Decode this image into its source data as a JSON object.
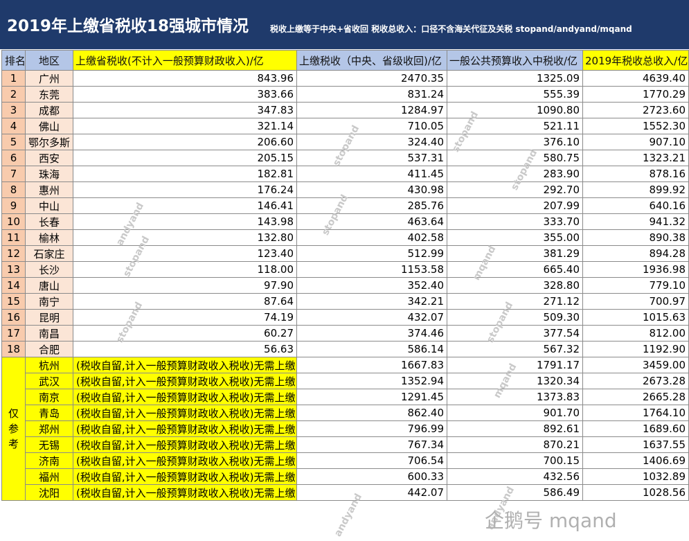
{
  "header": {
    "title": "2019年上缴省税收18强城市情况",
    "note": "税收上缴等于中央+省收回   税收总收入：口径不含海关代征及关税   stopand/andyand/mqand"
  },
  "columns": [
    "排名",
    "地区",
    "上缴省税收(不计入一般预算财政收入)/亿",
    "上缴税收（中央、省级收回)/亿",
    "一般公共预算收入中税收/亿",
    "2019年税收总收入/亿"
  ],
  "rows": [
    {
      "rank": "1",
      "city": "广州",
      "province_tax": "843.96",
      "upper_tax": "2470.35",
      "local_tax": "1325.09",
      "total": "4639.40"
    },
    {
      "rank": "2",
      "city": "东莞",
      "province_tax": "383.66",
      "upper_tax": "831.24",
      "local_tax": "555.39",
      "total": "1770.29"
    },
    {
      "rank": "3",
      "city": "成都",
      "province_tax": "347.83",
      "upper_tax": "1284.97",
      "local_tax": "1090.80",
      "total": "2723.60"
    },
    {
      "rank": "4",
      "city": "佛山",
      "province_tax": "321.14",
      "upper_tax": "710.05",
      "local_tax": "521.11",
      "total": "1552.30"
    },
    {
      "rank": "5",
      "city": "鄂尔多斯",
      "province_tax": "206.60",
      "upper_tax": "324.40",
      "local_tax": "376.10",
      "total": "907.10"
    },
    {
      "rank": "6",
      "city": "西安",
      "province_tax": "205.15",
      "upper_tax": "537.31",
      "local_tax": "580.75",
      "total": "1323.21"
    },
    {
      "rank": "7",
      "city": "珠海",
      "province_tax": "182.81",
      "upper_tax": "411.45",
      "local_tax": "283.90",
      "total": "878.16"
    },
    {
      "rank": "8",
      "city": "惠州",
      "province_tax": "176.24",
      "upper_tax": "430.98",
      "local_tax": "292.70",
      "total": "899.92"
    },
    {
      "rank": "9",
      "city": "中山",
      "province_tax": "146.41",
      "upper_tax": "285.76",
      "local_tax": "207.99",
      "total": "640.16"
    },
    {
      "rank": "10",
      "city": "长春",
      "province_tax": "143.98",
      "upper_tax": "463.64",
      "local_tax": "333.70",
      "total": "941.32"
    },
    {
      "rank": "11",
      "city": "榆林",
      "province_tax": "132.80",
      "upper_tax": "402.58",
      "local_tax": "355.00",
      "total": "890.38"
    },
    {
      "rank": "12",
      "city": "石家庄",
      "province_tax": "123.40",
      "upper_tax": "512.99",
      "local_tax": "381.29",
      "total": "894.28"
    },
    {
      "rank": "13",
      "city": "长沙",
      "province_tax": "118.00",
      "upper_tax": "1153.58",
      "local_tax": "665.40",
      "total": "1936.98"
    },
    {
      "rank": "14",
      "city": "唐山",
      "province_tax": "97.90",
      "upper_tax": "352.40",
      "local_tax": "328.80",
      "total": "779.10"
    },
    {
      "rank": "15",
      "city": "南宁",
      "province_tax": "87.64",
      "upper_tax": "342.21",
      "local_tax": "271.12",
      "total": "700.97"
    },
    {
      "rank": "16",
      "city": "昆明",
      "province_tax": "74.19",
      "upper_tax": "432.07",
      "local_tax": "509.30",
      "total": "1015.63"
    },
    {
      "rank": "17",
      "city": "南昌",
      "province_tax": "60.27",
      "upper_tax": "374.46",
      "local_tax": "377.54",
      "total": "812.00"
    },
    {
      "rank": "18",
      "city": "合肥",
      "province_tax": "56.63",
      "upper_tax": "586.14",
      "local_tax": "567.32",
      "total": "1192.90"
    }
  ],
  "reference": {
    "label": "仅参考",
    "note": "(税收自留,计入一般预算财政收入税收)无需上缴",
    "rows": [
      {
        "city": "杭州",
        "upper_tax": "1667.83",
        "local_tax": "1791.17",
        "total": "3459.00"
      },
      {
        "city": "武汉",
        "upper_tax": "1352.94",
        "local_tax": "1320.34",
        "total": "2673.28"
      },
      {
        "city": "南京",
        "upper_tax": "1291.45",
        "local_tax": "1373.83",
        "total": "2665.28"
      },
      {
        "city": "青岛",
        "upper_tax": "862.40",
        "local_tax": "901.70",
        "total": "1764.10"
      },
      {
        "city": "郑州",
        "upper_tax": "796.99",
        "local_tax": "892.61",
        "total": "1689.60"
      },
      {
        "city": "无锡",
        "upper_tax": "767.34",
        "local_tax": "870.21",
        "total": "1637.55"
      },
      {
        "city": "济南",
        "upper_tax": "706.54",
        "local_tax": "700.15",
        "total": "1406.69"
      },
      {
        "city": "福州",
        "upper_tax": "600.33",
        "local_tax": "432.56",
        "total": "1032.89"
      },
      {
        "city": "沈阳",
        "upper_tax": "442.07",
        "local_tax": "586.49",
        "total": "1028.56"
      }
    ]
  },
  "watermarks": [
    "stopand",
    "stopand",
    "stopand",
    "andyand",
    "stopand",
    "stopand",
    "mqand",
    "stopand",
    "stopand",
    "mqand",
    "andyand",
    "andyand"
  ],
  "footer_watermark": "企鹅号 mqand"
}
